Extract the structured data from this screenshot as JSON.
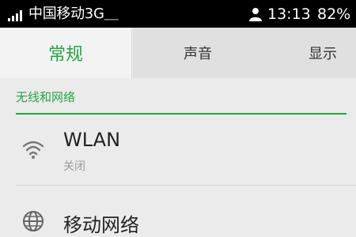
{
  "status_bar": {
    "carrier": "中国移动3G＿",
    "time": "13:13",
    "battery": "82%",
    "icons": [
      "signal-icon",
      "person-icon"
    ]
  },
  "tabs": [
    {
      "label": "常规",
      "active": true
    },
    {
      "label": "声音",
      "active": false
    },
    {
      "label": "显示",
      "active": false
    }
  ],
  "section": {
    "title": "无线和网络"
  },
  "rows": [
    {
      "title": "WLAN",
      "subtitle": "关闭",
      "icon": "wifi-icon"
    },
    {
      "title": "移动网络",
      "icon": "globe-icon"
    }
  ],
  "colors": {
    "accent": "#27a244",
    "status_bar": "#000000",
    "background": "#ebebeb"
  }
}
